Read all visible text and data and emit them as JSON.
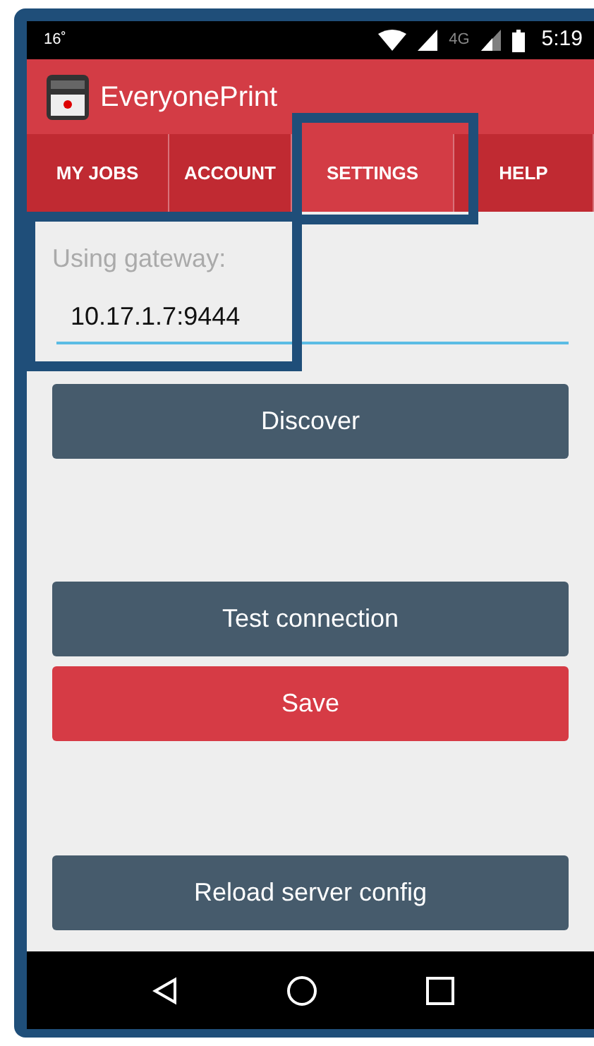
{
  "status_bar": {
    "left": "16˚",
    "network": "4G",
    "time": "5:19"
  },
  "app_bar": {
    "title": "EveryonePrint"
  },
  "tabs": [
    {
      "label": "MY JOBS",
      "selected": false
    },
    {
      "label": "ACCOUNT",
      "selected": false
    },
    {
      "label": "SETTINGS",
      "selected": true
    },
    {
      "label": "HELP",
      "selected": false
    }
  ],
  "gateway": {
    "label": "Using gateway:",
    "value": "10.17.1.7:9444"
  },
  "buttons": [
    {
      "label": "Discover",
      "kind": "secondary"
    },
    {
      "label": "Test connection",
      "kind": "secondary"
    },
    {
      "label": "Save",
      "kind": "primary"
    },
    {
      "label": "Reload server config",
      "kind": "secondary"
    }
  ]
}
